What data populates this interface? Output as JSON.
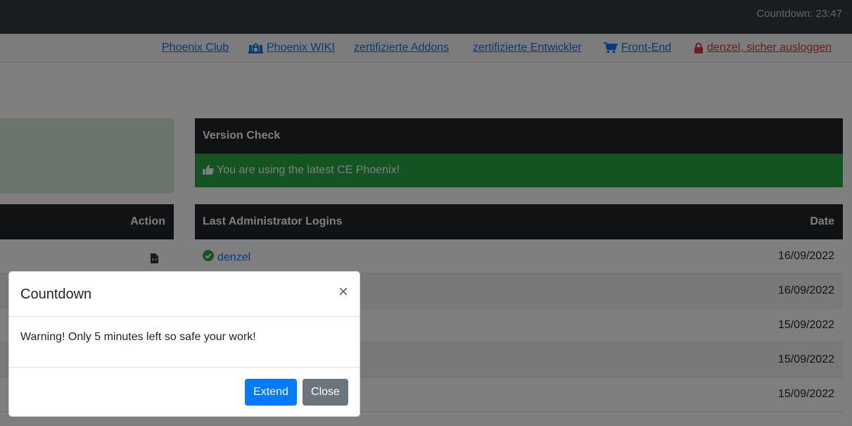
{
  "topbar": {
    "countdown": "Countdown: 23:47"
  },
  "nav": {
    "links": [
      {
        "label": "Phoenix Club",
        "icon": ""
      },
      {
        "label": "Phoenix WIKI",
        "icon": "university-icon"
      },
      {
        "label": "zertifizierte Addons",
        "icon": ""
      },
      {
        "label": "zertifizierte Entwickler",
        "icon": ""
      },
      {
        "label": "Front-End",
        "icon": "shopping-cart-icon"
      },
      {
        "label": "denzel, sicher ausloggen",
        "icon": "lock-icon"
      }
    ]
  },
  "left_table": {
    "header": "Action"
  },
  "version_check": {
    "header": "Version Check",
    "message": "You are using the latest CE Phoenix!"
  },
  "logins": {
    "header_left": "Last Administrator Logins",
    "header_right": "Date",
    "rows": [
      {
        "user": "denzel",
        "date": "16/09/2022"
      },
      {
        "user": "",
        "date": "16/09/2022"
      },
      {
        "user": "",
        "date": "15/09/2022"
      },
      {
        "user": "",
        "date": "15/09/2022"
      },
      {
        "user": "",
        "date": "15/09/2022"
      }
    ]
  },
  "modal": {
    "title": "Countdown",
    "close": "×",
    "body": "Warning! Only 5 minutes left so safe your work!",
    "extend": "Extend",
    "close_button": "Close"
  },
  "colors": {
    "dark": "#212529",
    "primary": "#007bff",
    "success": "#28a745",
    "danger": "#dc3545",
    "secondary": "#6c757d"
  }
}
